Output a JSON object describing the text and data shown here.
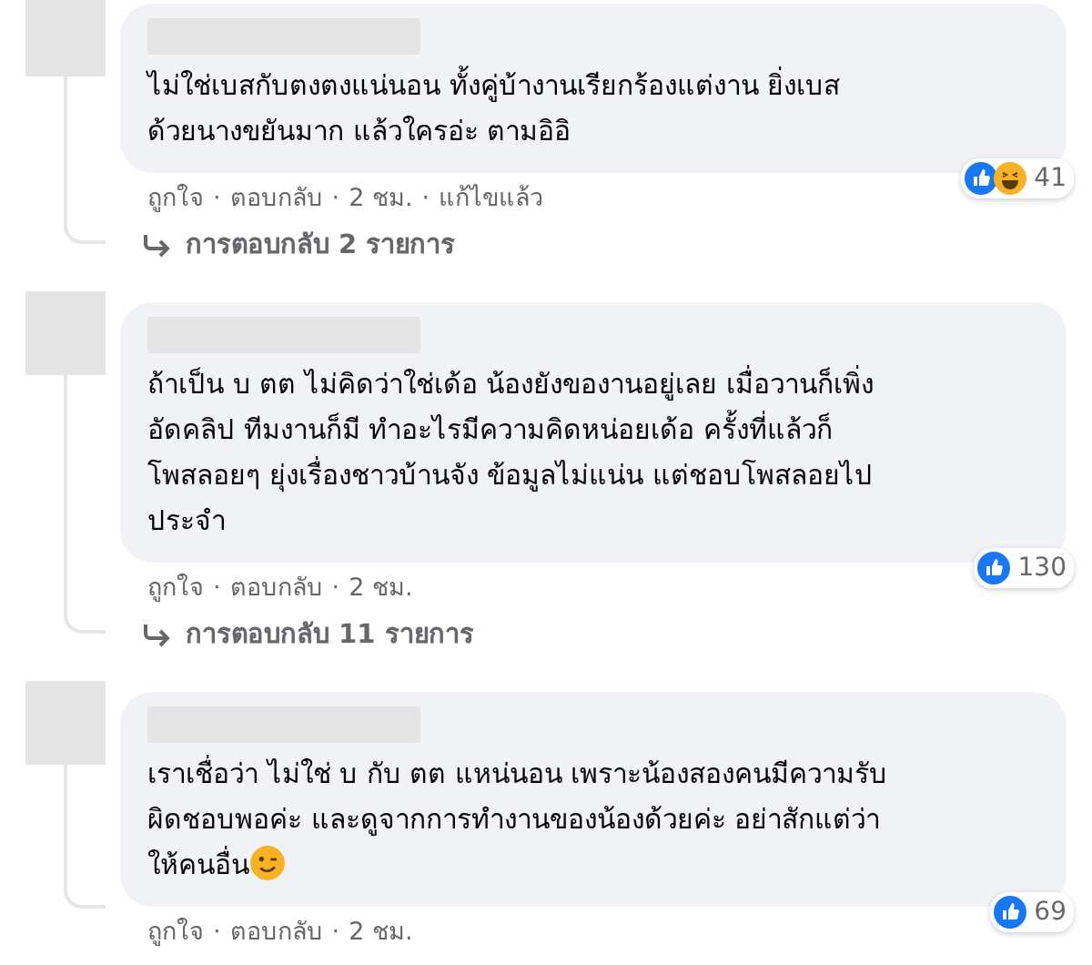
{
  "comments": [
    {
      "text": "ไม่ใช่เบสกับตงตงแน่นอน ทั้งคู่บ้างานเรียกร้องแต่งาน ยิ่งเบส\nด้วยนางขยันมาก แล้วใครอ่ะ ตามอิอิ",
      "reactions": [
        {
          "kind": "like"
        },
        {
          "kind": "haha"
        }
      ],
      "count": "41",
      "actions": [
        "ถูกใจ",
        "ตอบกลับ",
        "2 ชม.",
        "แก้ไขแล้ว"
      ],
      "separators": [
        "·",
        "·",
        "·"
      ],
      "replies": "การตอบกลับ 2 รายการ"
    },
    {
      "text": "ถ้าเป็น บ ตต ไม่คิดว่าใช่เด้อ น้องยังของานอยู่เลย เมื่อวานก็เพิ่ง\nอัดคลิป ทีมงานก็มี ทำอะไรมีความคิดหน่อยเด้อ ครั้งที่แล้วก็\nโพสลอยๆ ยุ่งเรื่องชาวบ้านจัง ข้อมูลไม่แน่น แต่ชอบโพสลอยไป\nประจำ",
      "reactions": [
        {
          "kind": "like"
        }
      ],
      "count": "130",
      "actions": [
        "ถูกใจ",
        "ตอบกลับ",
        "2 ชม."
      ],
      "separators": [
        "·",
        "·"
      ],
      "replies": "การตอบกลับ 11 รายการ"
    },
    {
      "text": "เราเชื่อว่า ไม่ใช่ บ กับ ตต แหน่นอน เพราะน้องสองคนมีความรับ\nผิดชอบพอค่ะ และดูจากการทำงานของน้องด้วยค่ะ อย่าสักแต่ว่า\nให้คนอื่น",
      "emoji": {
        "kind": "wink"
      },
      "reactions": [
        {
          "kind": "like"
        }
      ],
      "count": "69",
      "actions": [
        "ถูกใจ",
        "ตอบกลับ",
        "2 ชม."
      ],
      "separators": [
        "·",
        "·"
      ]
    }
  ]
}
